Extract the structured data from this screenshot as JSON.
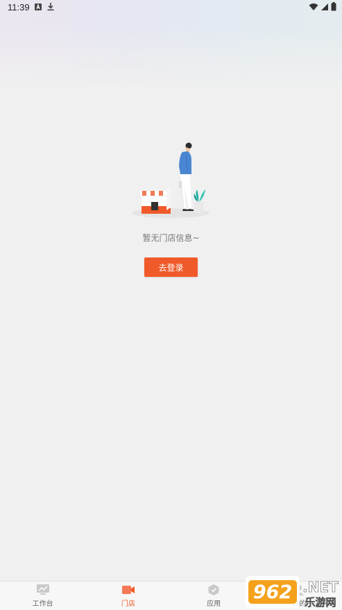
{
  "status_bar": {
    "time": "11:39"
  },
  "empty_state": {
    "message": "暂无门店信息~",
    "button_label": "去登录"
  },
  "tabbar": {
    "tabs": [
      {
        "label": "工作台",
        "icon": "workbench-icon",
        "active": false
      },
      {
        "label": "门店",
        "icon": "store-icon",
        "active": true
      },
      {
        "label": "应用",
        "icon": "apps-icon",
        "active": false
      },
      {
        "label": "我的",
        "icon": "profile-icon",
        "active": false
      }
    ]
  },
  "watermark": {
    "number": "962",
    "suffix": ".NET",
    "sub": "乐游网"
  },
  "colors": {
    "accent": "#f05a2a",
    "teal": "#29b5a7",
    "blue": "#4a86d1"
  }
}
